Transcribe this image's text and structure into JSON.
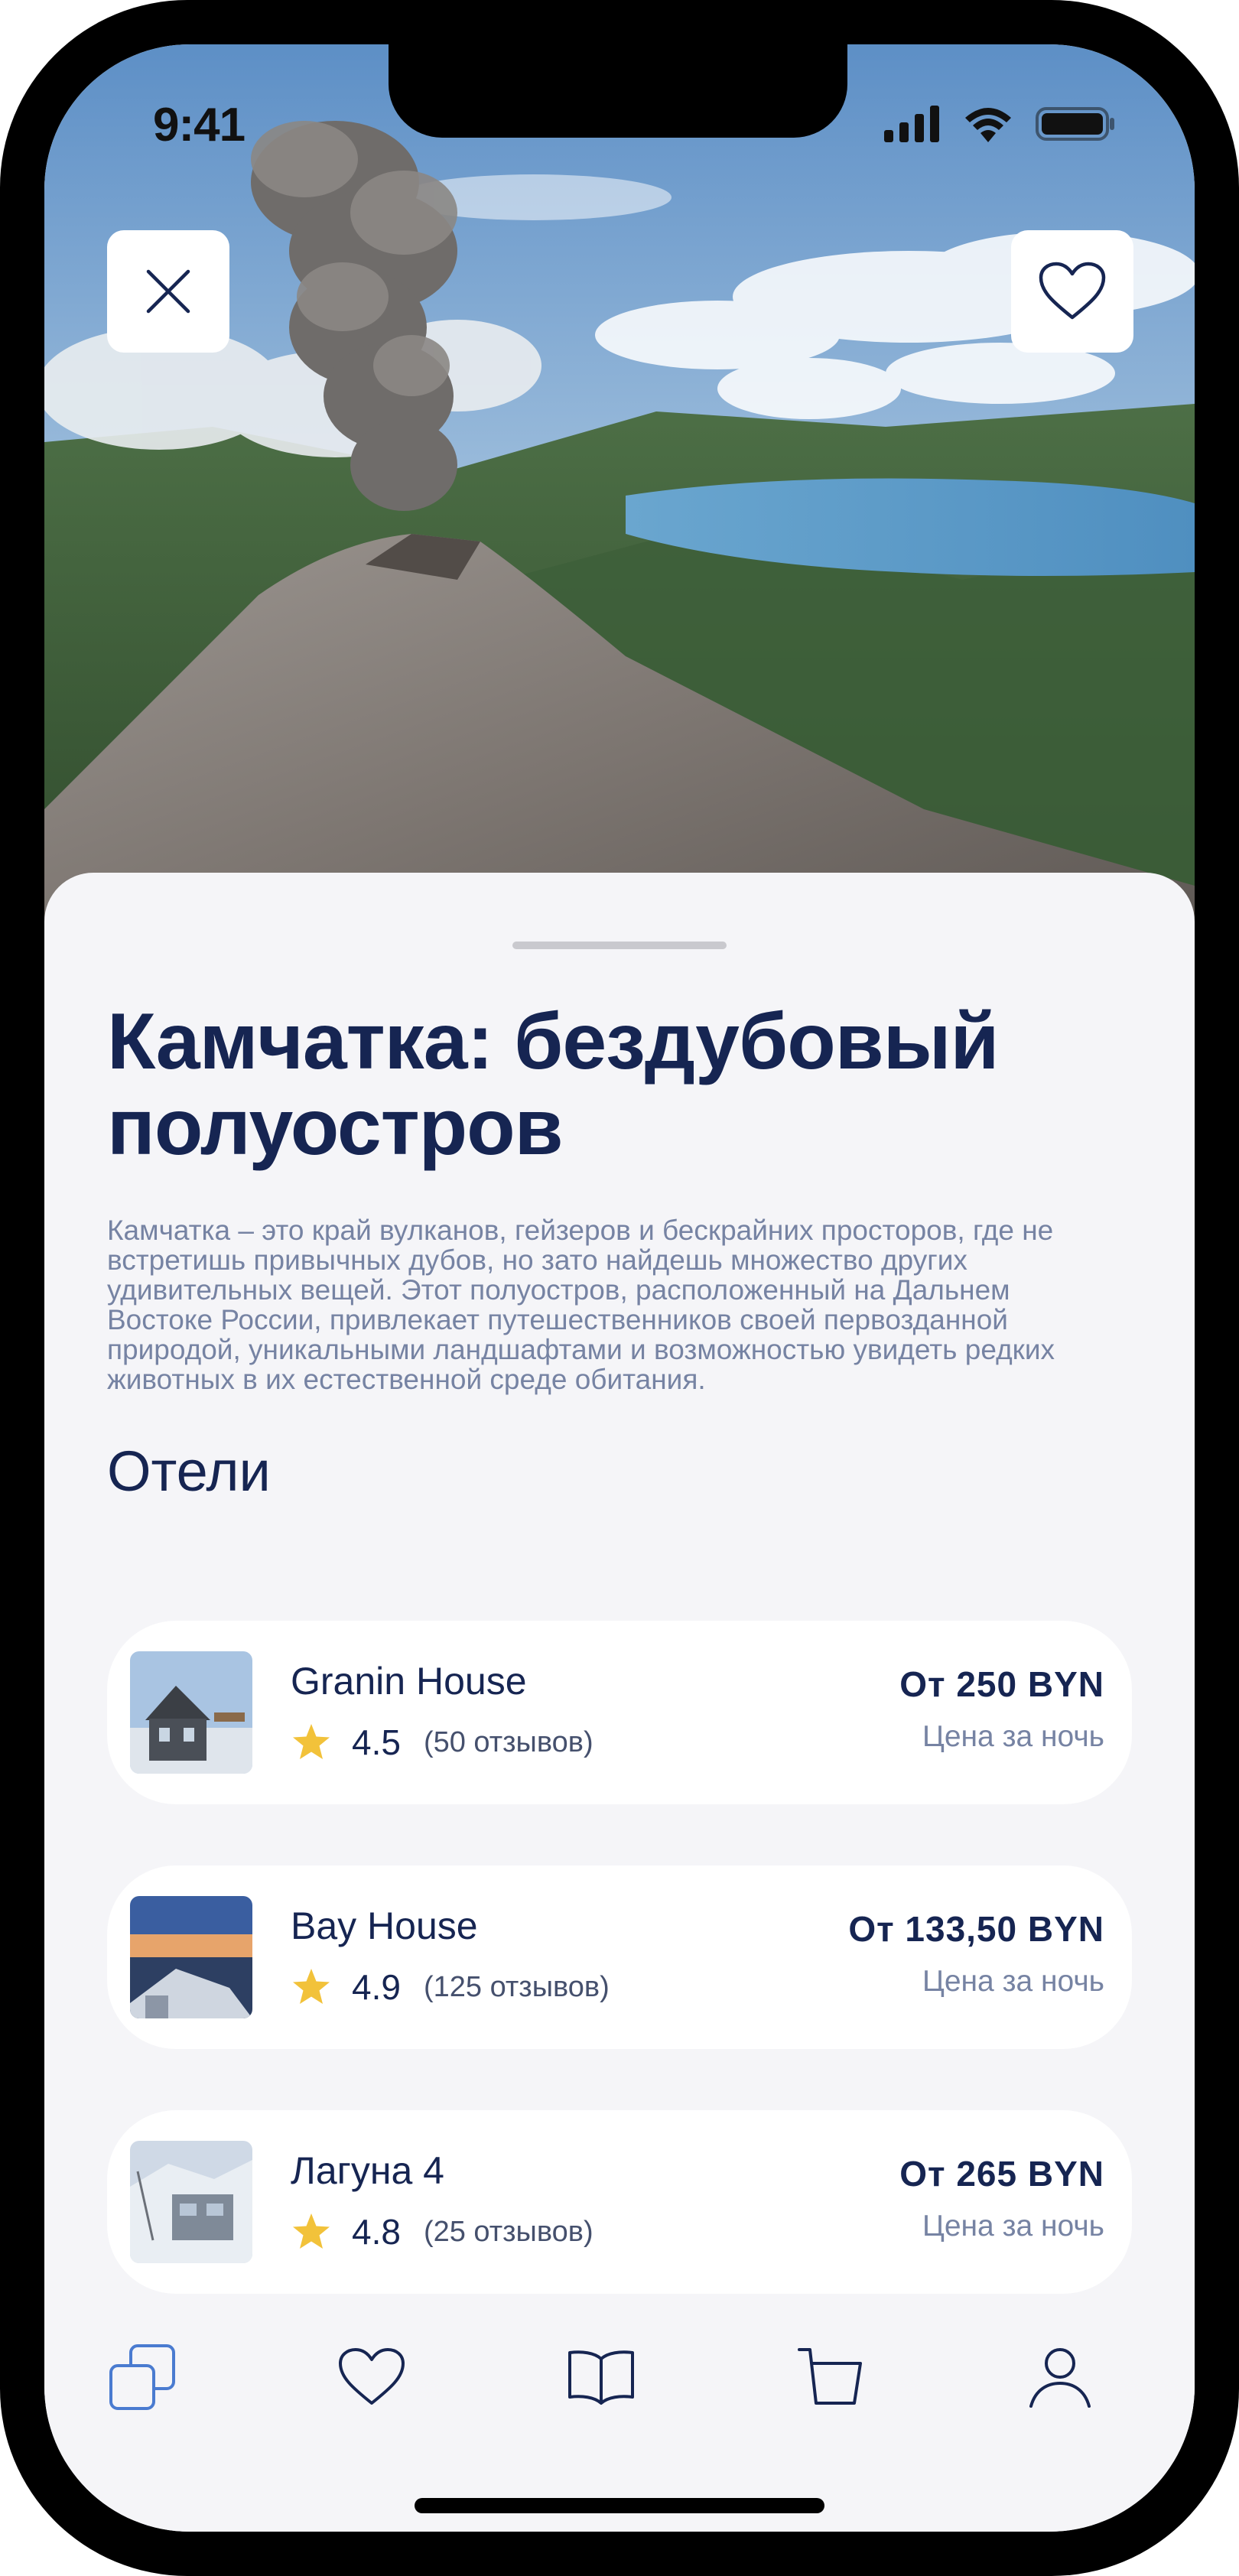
{
  "status": {
    "time": "9:41"
  },
  "hero": {
    "close_icon": "close-icon",
    "favorite_icon": "heart-icon"
  },
  "article": {
    "title": "Камчатка: бездубовый полуостров",
    "description": "Камчатка – это край вулканов, гейзеров и бескрайних просторов, где не встретишь привычных дубов, но зато найдешь множество других удивительных вещей. Этот полуостров, расположенный на Дальнем Востоке России, привлекает путешественников своей первозданной природой, уникальными ландшафтами и возможностью увидеть редких животных в их естественной среде обитания."
  },
  "hotels": {
    "section_title": "Отели",
    "items": [
      {
        "name": "Granin House",
        "rating": "4.5",
        "reviews": "(50 отзывов)",
        "price": "От 250 BYN",
        "price_note": "Цена за ночь"
      },
      {
        "name": "Bay House",
        "rating": "4.9",
        "reviews": "(125 отзывов)",
        "price": "От 133,50 BYN",
        "price_note": "Цена за ночь"
      },
      {
        "name": "Лагуна 4",
        "rating": "4.8",
        "reviews": "(25 отзывов)",
        "price": "От 265 BYN",
        "price_note": "Цена за ночь"
      }
    ]
  },
  "tabbar": {
    "items": [
      {
        "icon": "catalog-icon",
        "active": true
      },
      {
        "icon": "heart-icon",
        "active": false
      },
      {
        "icon": "book-icon",
        "active": false
      },
      {
        "icon": "cart-icon",
        "active": false
      },
      {
        "icon": "profile-icon",
        "active": false
      }
    ]
  },
  "colors": {
    "primary": "#162552",
    "muted": "#7683a3",
    "accent": "#4a7bd0",
    "star": "#f2c23a",
    "background": "#f5f5f8"
  }
}
